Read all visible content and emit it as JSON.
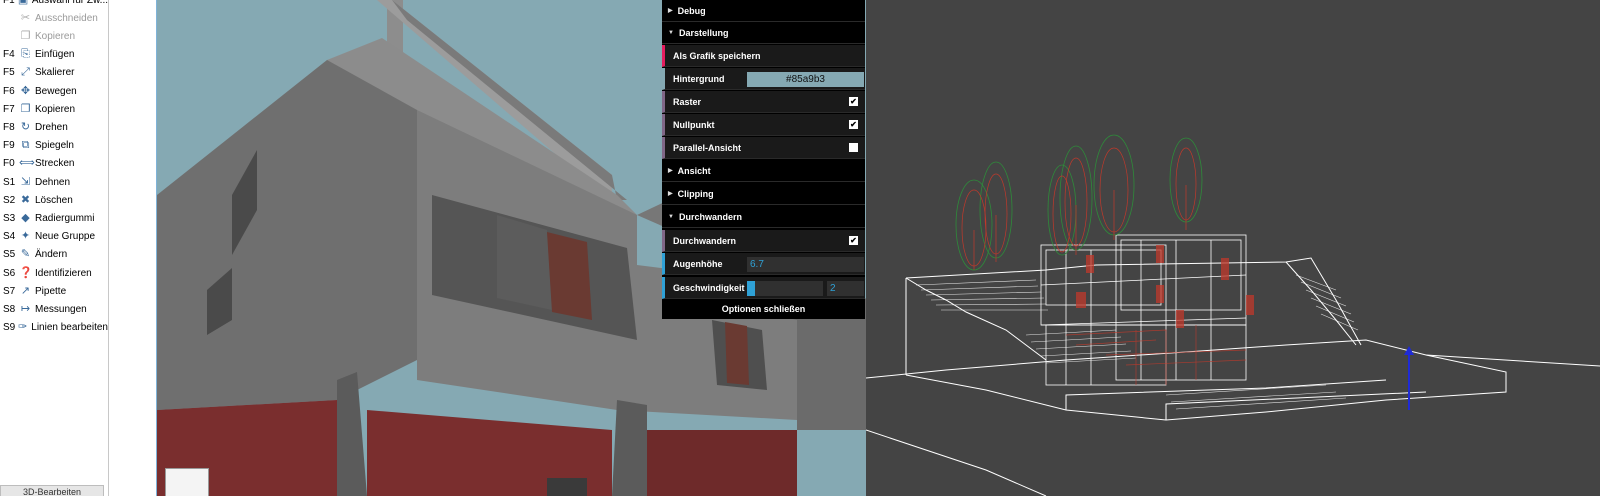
{
  "tools": [
    {
      "key": "F1",
      "label": "Auswahl für Zw...",
      "icon": "select-icon",
      "disabled": false
    },
    {
      "key": "",
      "label": "Ausschneiden",
      "icon": "scissors-icon",
      "disabled": true
    },
    {
      "key": "",
      "label": "Kopieren",
      "icon": "copy-icon",
      "disabled": true
    },
    {
      "key": "F4",
      "label": "Einfügen",
      "icon": "paste-icon",
      "disabled": false
    },
    {
      "key": "F5",
      "label": "Skalierer",
      "icon": "scale-icon",
      "disabled": false
    },
    {
      "key": "F6",
      "label": "Bewegen",
      "icon": "move-icon",
      "disabled": false
    },
    {
      "key": "F7",
      "label": "Kopieren",
      "icon": "copy-icon",
      "disabled": false
    },
    {
      "key": "F8",
      "label": "Drehen",
      "icon": "rotate-icon",
      "disabled": false
    },
    {
      "key": "F9",
      "label": "Spiegeln",
      "icon": "mirror-icon",
      "disabled": false
    },
    {
      "key": "F0",
      "label": "Strecken",
      "icon": "stretch-icon",
      "disabled": false
    },
    {
      "key": "S1",
      "label": "Dehnen",
      "icon": "extend-icon",
      "disabled": false
    },
    {
      "key": "S2",
      "label": "Löschen",
      "icon": "delete-icon",
      "disabled": false
    },
    {
      "key": "S3",
      "label": "Radiergummi",
      "icon": "eraser-icon",
      "disabled": false
    },
    {
      "key": "S4",
      "label": "Neue Gruppe",
      "icon": "group-icon",
      "disabled": false
    },
    {
      "key": "S5",
      "label": "Ändern",
      "icon": "pencil-icon",
      "disabled": false
    },
    {
      "key": "S6",
      "label": "Identifizieren",
      "icon": "identify-icon",
      "disabled": false
    },
    {
      "key": "S7",
      "label": "Pipette",
      "icon": "pipette-icon",
      "disabled": false
    },
    {
      "key": "S8",
      "label": "Messungen",
      "icon": "measure-icon",
      "disabled": false
    },
    {
      "key": "S9",
      "label": "Linien bearbeiten",
      "icon": "edit-lines-icon",
      "disabled": false
    }
  ],
  "panel_footer": "3D-Bearbeiten",
  "options": {
    "debug": "Debug",
    "darstellung": "Darstellung",
    "save_image": "Als Grafik speichern",
    "background_label": "Hintergrund",
    "background_value": "#85a9b3",
    "grid_label": "Raster",
    "grid_checked": true,
    "origin_label": "Nullpunkt",
    "origin_checked": true,
    "parallel_label": "Parallel-Ansicht",
    "parallel_checked": false,
    "ansicht": "Ansicht",
    "clipping": "Clipping",
    "walk_folder": "Durchwandern",
    "walk_label": "Durchwandern",
    "walk_checked": true,
    "eye_height_label": "Augenhöhe",
    "eye_height_value": "6.7",
    "speed_label": "Geschwindigkeit",
    "speed_value": "2",
    "speed_fraction": 0.1,
    "close": "Optionen schließen"
  },
  "colors": {
    "sky": "#85a9b3",
    "wall": "#6f6f6f",
    "red_base": "#7a2e2e",
    "wire_bg": "#444444"
  }
}
